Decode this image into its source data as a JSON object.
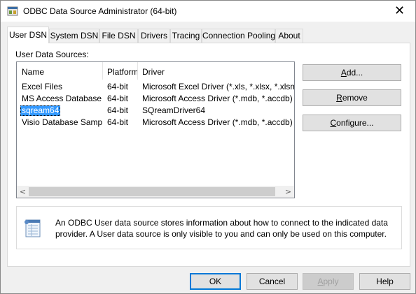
{
  "window": {
    "title": "ODBC Data Source Administrator (64-bit)",
    "close_glyph": "✕",
    "app_icon": "odbc-admin-icon"
  },
  "tabs": [
    {
      "label": "User DSN",
      "active": true
    },
    {
      "label": "System DSN"
    },
    {
      "label": "File DSN"
    },
    {
      "label": "Drivers"
    },
    {
      "label": "Tracing"
    },
    {
      "label": "Connection Pooling"
    },
    {
      "label": "About"
    }
  ],
  "user_dsn": {
    "section_label": "User Data Sources:",
    "columns": {
      "name": "Name",
      "platform": "Platform",
      "driver": "Driver"
    },
    "rows": [
      {
        "name": "Excel Files",
        "platform": "64-bit",
        "driver": "Microsoft Excel Driver (*.xls, *.xlsx, *.xlsm, *.xlsb)"
      },
      {
        "name": "MS Access Database",
        "platform": "64-bit",
        "driver": "Microsoft Access Driver (*.mdb, *.accdb)"
      },
      {
        "name": "sqream64",
        "platform": "64-bit",
        "driver": "SQreamDriver64",
        "selected": true
      },
      {
        "name": "Visio Database Samples",
        "platform": "64-bit",
        "driver": "Microsoft Access Driver (*.mdb, *.accdb)"
      }
    ],
    "scroll_left": "<",
    "scroll_right": ">",
    "buttons": {
      "add": "Add...",
      "remove": "Remove",
      "configure": "Configure..."
    },
    "info_text": "An ODBC User data source stores information about how to connect to the indicated data provider.   A User data source is only visible to you and can only be used on this computer.",
    "info_icon": "user-data-source-icon"
  },
  "footer": {
    "ok": "OK",
    "cancel": "Cancel",
    "apply": "Apply",
    "help": "Help"
  },
  "colors": {
    "selection": "#3399ff",
    "default_button_border": "#0078d7",
    "dialog_bg": "#f0f0f0"
  }
}
